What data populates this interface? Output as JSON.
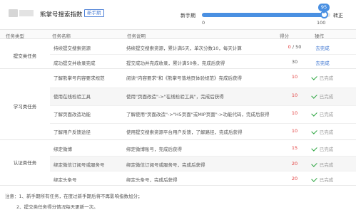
{
  "header": {
    "title": "熊掌号搜索指数",
    "badge": "新手期"
  },
  "stage": {
    "current_label": "新手期",
    "next_label": "转正",
    "score_display": "95",
    "score": 95,
    "min_label": "0",
    "max_label": "100",
    "accent_color": "#4a90e2"
  },
  "table": {
    "headers": [
      "任务类型",
      "任务名称",
      "任务说明",
      "得分",
      "操作"
    ],
    "groups": [
      {
        "label": "提交类任务",
        "rows": [
          {
            "name": "持续提交搜索资源",
            "desc": "持续提交搜索资源，累计满5天，单次分数10，每天计算",
            "score_red": "0",
            "score_rest": " / 50",
            "action": "去完成",
            "action_kind": "link"
          },
          {
            "name": "成功提交并收录完成",
            "desc": "提交成功并完成收录，累计满50条，完成后获得",
            "score_red": "",
            "score_rest": "30",
            "action": "去完成",
            "action_kind": "link"
          }
        ]
      },
      {
        "label": "学习类任务",
        "rows": [
          {
            "name": "了解熊掌号内容要求规范",
            "desc": "阅读\"内容要求\"和《熊掌号落地页体验规范》完成后获得",
            "score_red": "10",
            "score_rest": "",
            "action": "已完成",
            "action_kind": "done"
          },
          {
            "name": "使用在线检验工具",
            "desc": "使用\"页面改造\"->\"在线检验工具\"，完成后获得",
            "score_red": "10",
            "score_rest": "",
            "action": "已完成",
            "action_kind": "done"
          },
          {
            "name": "了解页面改造功能",
            "desc": "了解使用\"页面改造\"->\"H5页面\"或MIP页面\"->功能代码，完成后获得",
            "score_red": "10",
            "score_rest": "",
            "action": "已完成",
            "action_kind": "done"
          },
          {
            "name": "了解用户反馈途径",
            "desc": "使用提交搜索资源平台用户反馈，了解路径，完成后获得",
            "score_red": "10",
            "score_rest": "",
            "action": "已完成",
            "action_kind": "done"
          }
        ]
      },
      {
        "label": "认证类任务",
        "rows": [
          {
            "name": "绑定微博",
            "desc": "绑定微博账号，完成后获得",
            "score_red": "15",
            "score_rest": "",
            "action": "已完成",
            "action_kind": "done"
          },
          {
            "name": "绑定微信订阅号或服务号",
            "desc": "绑定微信订阅号或服务号，完成后获得",
            "score_red": "20",
            "score_rest": "",
            "action": "已完成",
            "action_kind": "done"
          },
          {
            "name": "绑定头条号",
            "desc": "绑定头条号，完成后获得",
            "score_red": "20",
            "score_rest": "",
            "action": "已完成",
            "action_kind": "done"
          }
        ]
      }
    ]
  },
  "notes": [
    "注意：1、新手期所有任务，在度过新手期后将不再影响指数加分；",
    "2、提交类任务得分情况每天更新一次。"
  ]
}
